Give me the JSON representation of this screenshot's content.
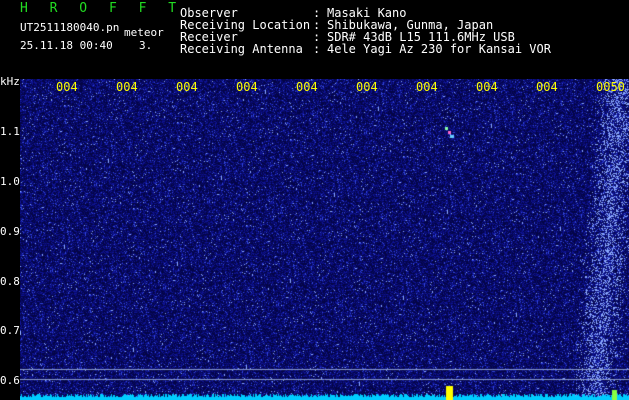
{
  "header": {
    "title": "H R O F F T",
    "filename": "UT2511180040.pn",
    "meteor_label": "meteor",
    "datetime": "25.11.18 00:40",
    "count": "3."
  },
  "info": [
    {
      "label": "Observer",
      "sep": ":",
      "value": "Masaki Kano"
    },
    {
      "label": "Receiving Location",
      "sep": ":",
      "value": "Shibukawa, Gunma, Japan"
    },
    {
      "label": "Receiver",
      "sep": ":",
      "value": "SDR# 43dB L15 111.6MHz USB"
    },
    {
      "label": "Receiving Antenna",
      "sep": ":",
      "value": "4ele Yagi Az 230 for Kansai VOR"
    }
  ],
  "x_ticks": [
    "004",
    "004",
    "004",
    "004",
    "004",
    "004",
    "004",
    "004",
    "004",
    "0050"
  ],
  "y_unit": "kHz",
  "y_ticks": [
    "1.1",
    "1.0",
    "0.9",
    "0.8",
    "0.7",
    "0.6"
  ],
  "colors": {
    "background": "#000000",
    "title": "#22dd22",
    "tick_labels": "#ffff00",
    "text": "#ffffff",
    "noise_base": "#0a0a6e",
    "noise_bright": "#6a8cff",
    "baseline": "#00ccff",
    "meteor_marker": "#ffff00"
  }
}
